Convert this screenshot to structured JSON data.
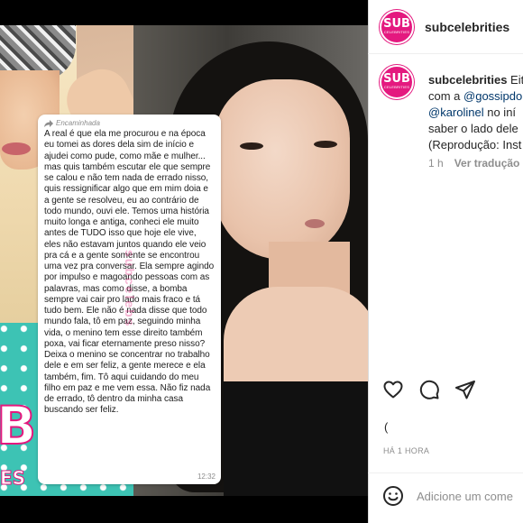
{
  "post": {
    "message": {
      "forward_label": "Encaminhada",
      "body": "A real é que ela me procurou e na época eu tomei as dores dela sim de início e ajudei como pude, como mãe e mulher... mas quis também escutar ele que sempre se calou e não tem nada de errado nisso, quis ressignificar algo que em mim doia e a gente se resolveu, eu ao contrário de todo mundo, ouvi ele. Temos uma história muito longa e antiga, conheci ele muito antes de TUDO isso que hoje ele vive, eles não estavam juntos quando ele veio pra cá e a gente somente se encontrou uma vez pra conversar. Ela sempre agindo por impulso e magoando pessoas com as palavras, mas como disse, a bomba sempre vai cair pro lado mais fraco e tá tudo bem. Ele não é nada disse que todo mundo fala, tô em paz, seguindo minha vida, o menino tem esse direito também poxa, vai ficar eternamente preso nisso? Deixa o menino se concentrar no trabalho dele e em ser feliz, a gente merece e ela também, fim. Tô aqui cuidando do meu filho em paz e me vem essa. Não fiz nada de errado, tô dentro da minha casa buscando ser feliz.",
      "time": "12:32",
      "watermark": "subcelebs"
    },
    "left_photo_text": {
      "big": "B",
      "small": "ES"
    }
  },
  "sidebar": {
    "username": "subcelebrities",
    "avatar": {
      "top": "SUB",
      "bottom": "CELEBRITIES"
    },
    "caption": {
      "username": "subcelebrities",
      "line1_rest": " Eit",
      "line2_prefix": "com a ",
      "mention1": "@gossipdo",
      "mention2": "@karolinel",
      "line3_rest": " no iní",
      "line4": "saber o lado dele",
      "line5": "(Reprodução: Inst"
    },
    "caption_meta": {
      "age": "1 h",
      "translate": "Ver tradução"
    },
    "likes_line": "(",
    "time_ago": "HÁ 1 HORA",
    "add_comment_placeholder": "Adicione um come"
  },
  "colors": {
    "brand": "#e4197f",
    "link": "#00376b",
    "muted": "#8e8e8e"
  }
}
